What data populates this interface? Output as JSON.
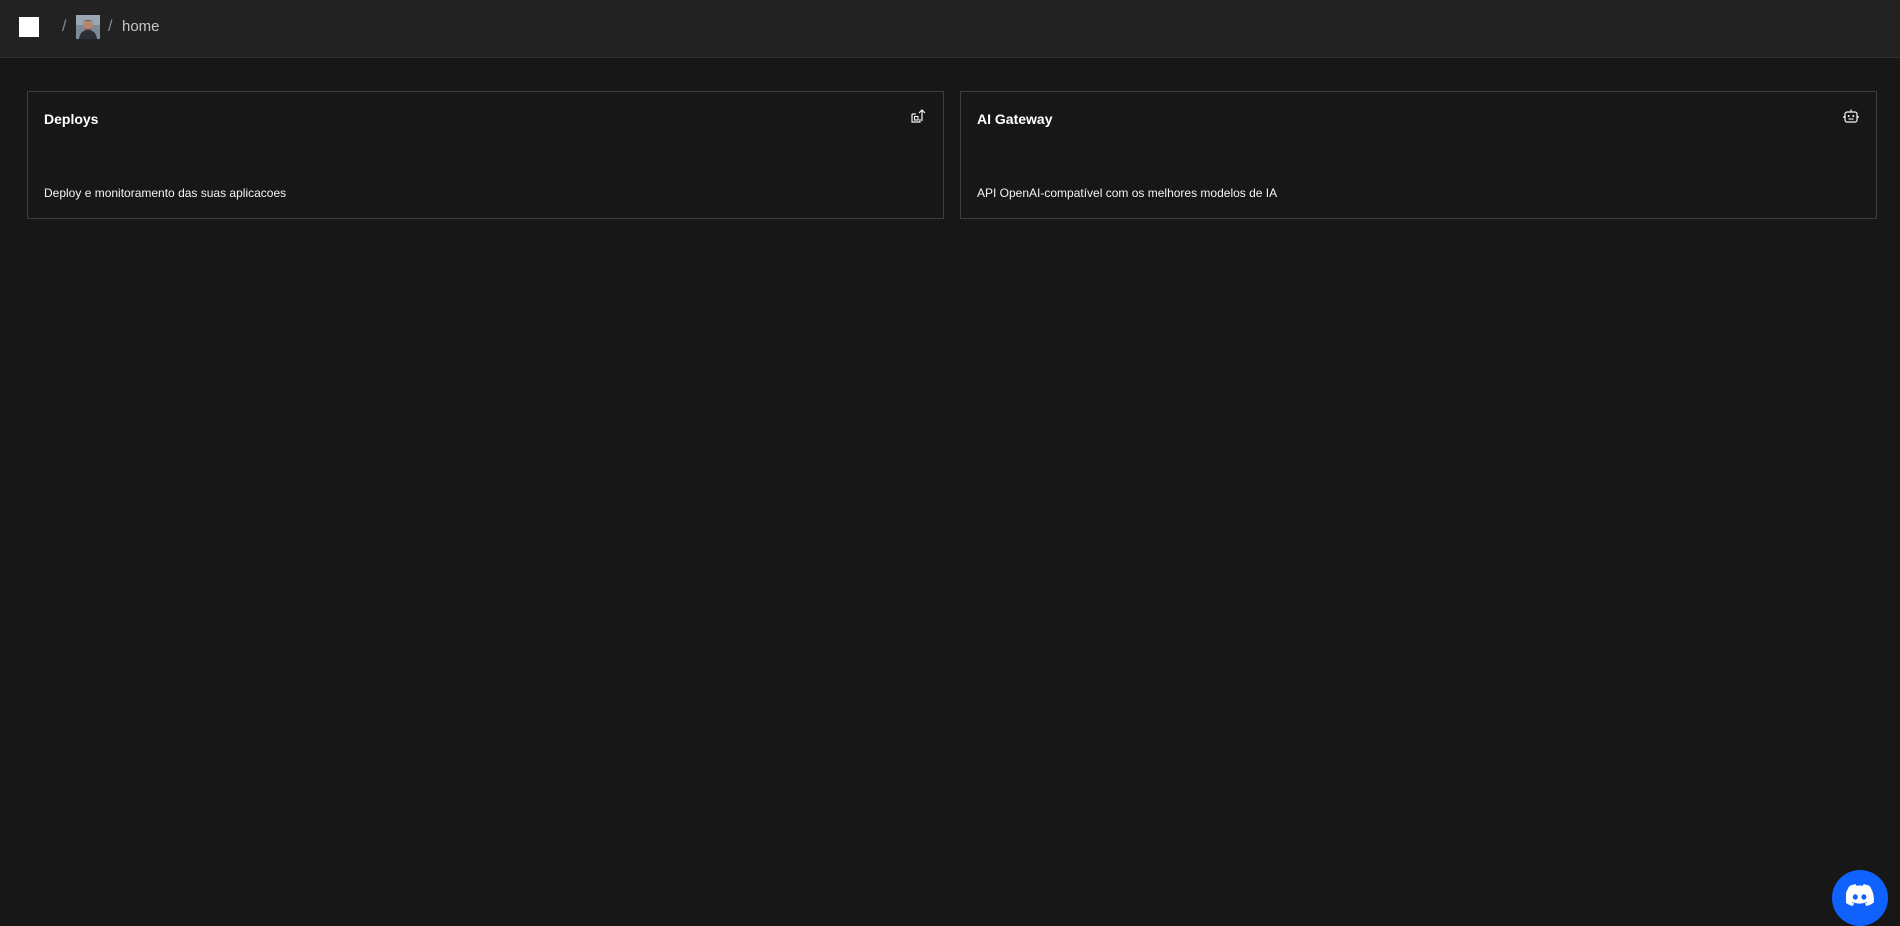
{
  "header": {
    "logo_icon": "square-logo-icon",
    "separator": "/",
    "avatar_icon": "user-avatar",
    "current_page": "home"
  },
  "cards": [
    {
      "title": "Deploys",
      "description": "Deploy e monitoramento das suas aplicacoes",
      "icon": "deploy-icon"
    },
    {
      "title": "AI Gateway",
      "description": "API OpenAI-compatível com os melhores modelos de IA",
      "icon": "bot-icon"
    }
  ],
  "floating_button": {
    "icon": "discord-icon",
    "color": "#0f62fe"
  },
  "colors": {
    "background": "#171717",
    "header": "#222222",
    "card_border": "#3d3d3d",
    "accent": "#0f62fe"
  }
}
